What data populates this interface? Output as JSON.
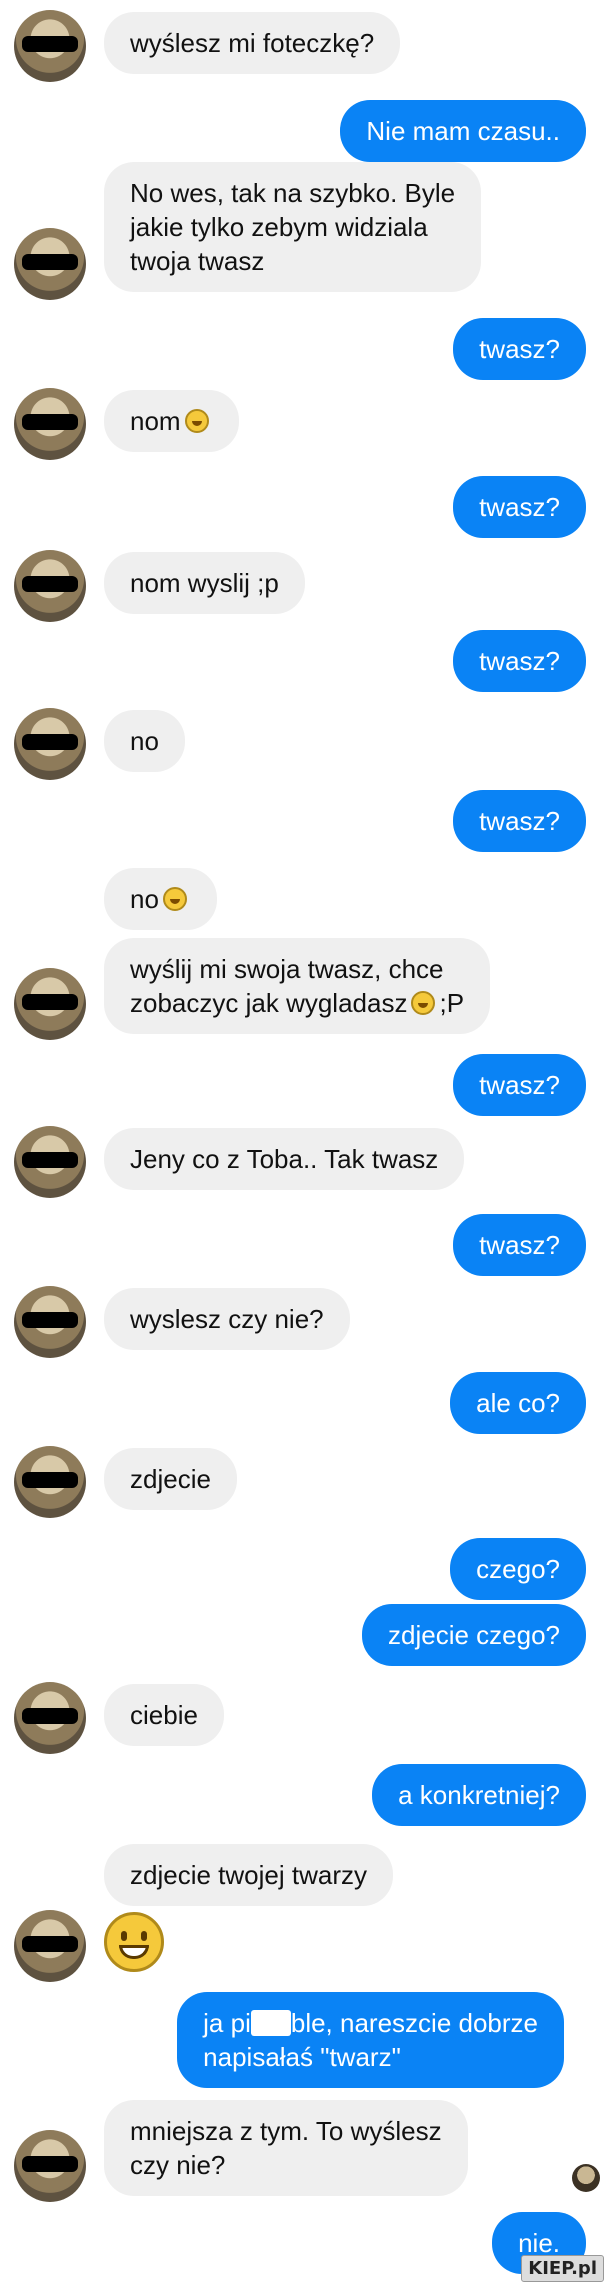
{
  "colors": {
    "incoming_bubble": "#efefef",
    "outgoing_bubble": "#0a83f5",
    "outgoing_text": "#ffffff"
  },
  "messages": [
    {
      "id": "m1",
      "text": "wyślesz mi foteczkę?"
    },
    {
      "id": "m2",
      "text": "Nie mam czasu.."
    },
    {
      "id": "m3",
      "text": "No wes, tak na szybko. Byle\njakie tylko zebym widziala\ntwoja twasz"
    },
    {
      "id": "m4",
      "text": "twasz?"
    },
    {
      "id": "m5",
      "text": "nom"
    },
    {
      "id": "m6",
      "text": "twasz?"
    },
    {
      "id": "m7",
      "text": "nom wyslij ;p"
    },
    {
      "id": "m8",
      "text": "twasz?"
    },
    {
      "id": "m9",
      "text": "no"
    },
    {
      "id": "m10",
      "text": "twasz?"
    },
    {
      "id": "m11",
      "text": "no"
    },
    {
      "id": "m12a",
      "text": "wyślij mi swoja twasz, chce\nzobaczyc jak wygladasz"
    },
    {
      "id": "m12b",
      "text": ";P"
    },
    {
      "id": "m13",
      "text": "twasz?"
    },
    {
      "id": "m14",
      "text": "Jeny co z Toba.. Tak twasz"
    },
    {
      "id": "m15",
      "text": "twasz?"
    },
    {
      "id": "m16",
      "text": "wyslesz czy nie?"
    },
    {
      "id": "m17",
      "text": "ale co?"
    },
    {
      "id": "m18",
      "text": "zdjecie"
    },
    {
      "id": "m19",
      "text": "czego?"
    },
    {
      "id": "m20",
      "text": "zdjecie czego?"
    },
    {
      "id": "m21",
      "text": "ciebie"
    },
    {
      "id": "m22",
      "text": "a konkretniej?"
    },
    {
      "id": "m23",
      "text": "zdjecie twojej twarzy"
    },
    {
      "id": "m24a",
      "text": "ja pi"
    },
    {
      "id": "m24b",
      "text": "ble, nareszcie dobrze\nnapisałaś \"twarz\""
    },
    {
      "id": "m25",
      "text": "mniejsza z tym. To wyślesz\nczy nie?"
    },
    {
      "id": "m26",
      "text": "nie."
    }
  ],
  "watermark": "KIEP.pl"
}
